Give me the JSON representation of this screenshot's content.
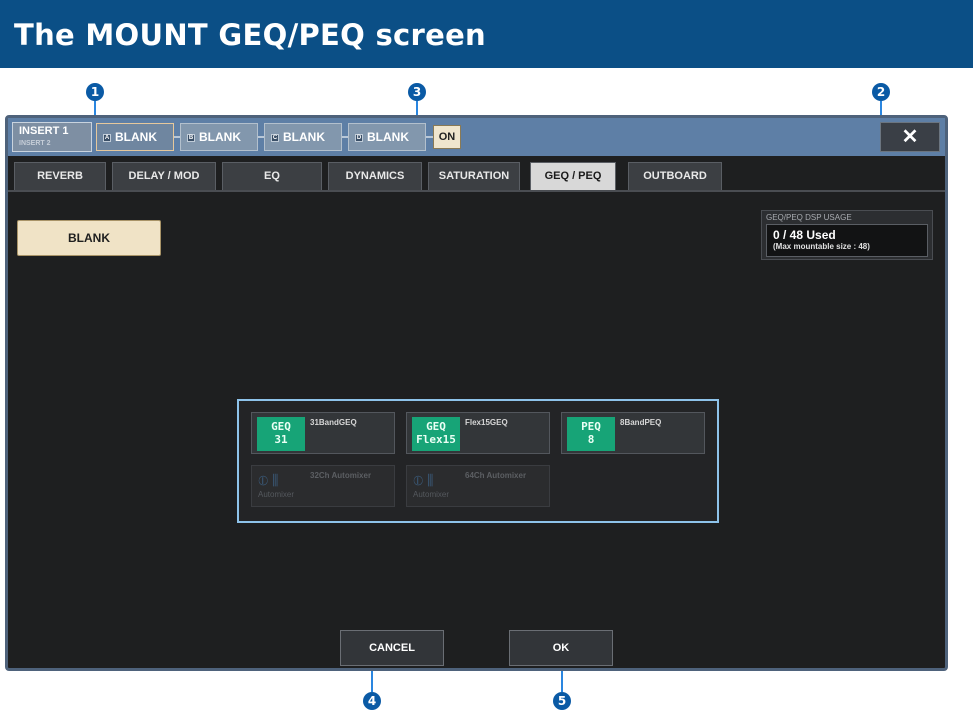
{
  "page_title": "The MOUNT GEQ/PEQ screen",
  "callouts": [
    "1",
    "2",
    "3",
    "4",
    "5"
  ],
  "insert": {
    "label": "INSERT 1",
    "sub": "INSERT 2"
  },
  "slots": [
    {
      "tag": "A",
      "label": "BLANK"
    },
    {
      "tag": "B",
      "label": "BLANK"
    },
    {
      "tag": "C",
      "label": "BLANK"
    },
    {
      "tag": "D",
      "label": "BLANK"
    }
  ],
  "on_label": "ON",
  "close_label": "✕",
  "tabs": [
    "REVERB",
    "DELAY / MOD",
    "EQ",
    "DYNAMICS",
    "SATURATION",
    "GEQ / PEQ",
    "OUTBOARD"
  ],
  "active_tab": "GEQ / PEQ",
  "blank_button": "BLANK",
  "dsp": {
    "title": "GEQ/PEQ DSP USAGE",
    "used": "0 / 48 Used",
    "max": "(Max mountable size : 48)"
  },
  "modules": [
    {
      "name": "31BandGEQ",
      "badge_top": "GEQ",
      "badge_bottom": "31",
      "enabled": true
    },
    {
      "name": "Flex15GEQ",
      "badge_top": "GEQ",
      "badge_bottom": "Flex15",
      "enabled": true
    },
    {
      "name": "8BandPEQ",
      "badge_top": "PEQ",
      "badge_bottom": "8",
      "enabled": true
    },
    {
      "name": "32Ch Automixer",
      "badge_text": "Automixer",
      "enabled": false
    },
    {
      "name": "64Ch Automixer",
      "badge_text": "Automixer",
      "enabled": false
    }
  ],
  "footer": {
    "cancel": "CANCEL",
    "ok": "OK"
  },
  "colors": {
    "header_blue": "#0b4f86",
    "callout": "#0a5aa5",
    "accent_green": "#17a477",
    "selection_frame": "#8ec3ea"
  }
}
